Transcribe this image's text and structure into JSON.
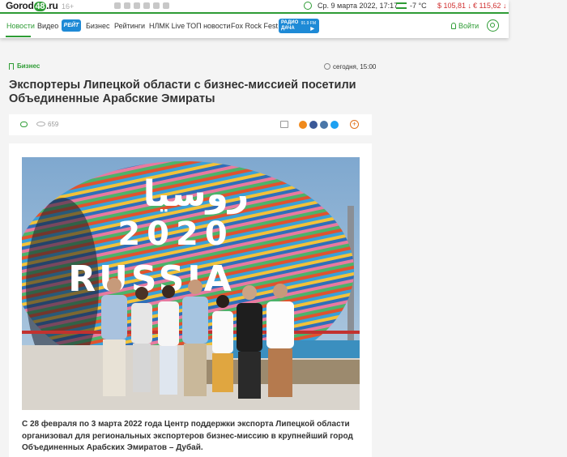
{
  "header": {
    "logo_text": "Gorod",
    "logo_num": "48",
    "logo_tld": ".ru",
    "age": "16+",
    "date": "Ср. 9 марта 2022,  17:17",
    "weather": "-7 °C",
    "usd": "$ 105,81 ↓",
    "eur": "€ 115,62 ↓"
  },
  "nav": {
    "items": [
      "Новости",
      "Видео",
      "Бизнес",
      "Рейтинги",
      "НЛМК Live",
      "ТОП новости",
      "Fox Rock Fest"
    ],
    "badge": "РЕЙТ",
    "radio_line1": "РАДИО",
    "radio_line2": "ДАЧА",
    "radio_freq": "91.9 FM",
    "login": "Войти"
  },
  "article": {
    "category": "Бизнес",
    "time": "сегодня, 15:00",
    "title": "Экспортеры Липецкой области с бизнес-миссией посетили Объединенные Арабские Эмираты",
    "views": "659",
    "photo_sign_top": "روسيا",
    "photo_sign_year": "2020",
    "photo_sign_name": "RUSSIA",
    "lead": "С 28 февраля по 3 марта 2022 года Центр поддержки экспорта Липецкой области организовал для региональных экспортеров бизнес-миссию в крупнейший город Объединенных Арабских Эмиратов – Дубай."
  },
  "colors": {
    "brand_green": "#2e9c35",
    "currency_red": "#d03030",
    "share_ok": "#f08a1c",
    "share_fb": "#3b5998",
    "share_vk": "#4a76a8",
    "share_tw": "#1da1f2"
  }
}
